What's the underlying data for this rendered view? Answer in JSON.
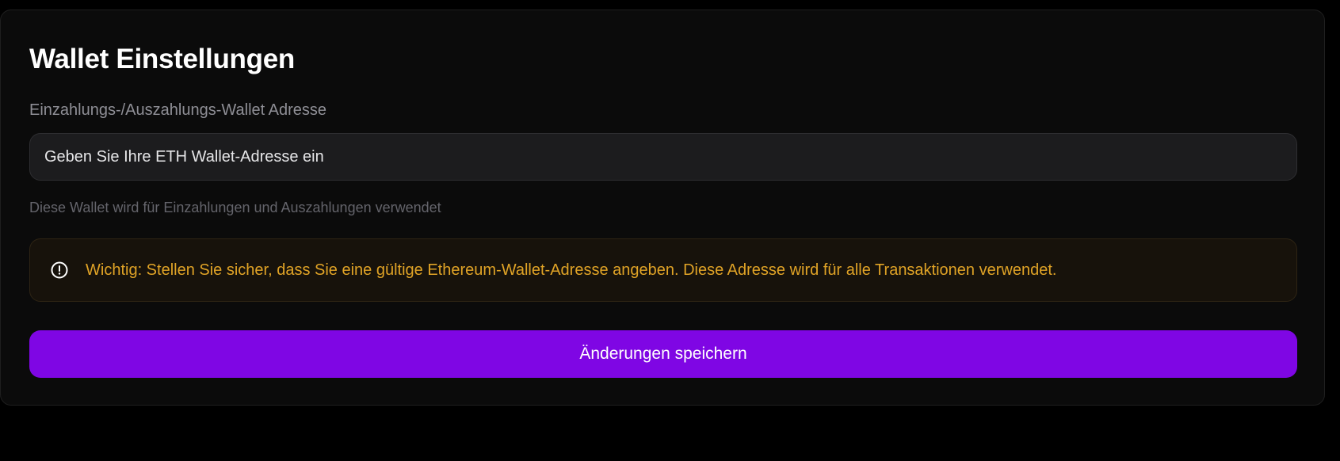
{
  "page": {
    "title": "Wallet Einstellungen"
  },
  "wallet_field": {
    "label": "Einzahlungs-/Auszahlungs-Wallet Adresse",
    "value": "",
    "placeholder": "Geben Sie Ihre ETH Wallet-Adresse ein",
    "helper": "Diese Wallet wird für Einzahlungen und Auszahlungen verwendet"
  },
  "alert": {
    "icon": "alert-circle-icon",
    "text": "Wichtig: Stellen Sie sicher, dass Sie eine gültige Ethereum-Wallet-Adresse angeben. Diese Adresse wird für alle Transaktionen verwendet."
  },
  "actions": {
    "save_label": "Änderungen speichern"
  },
  "colors": {
    "background": "#000000",
    "card": "#0b0b0b",
    "input_background": "#1c1c1e",
    "warning_text": "#e0a326",
    "warning_background": "#17120b",
    "accent": "#7f06e4"
  }
}
